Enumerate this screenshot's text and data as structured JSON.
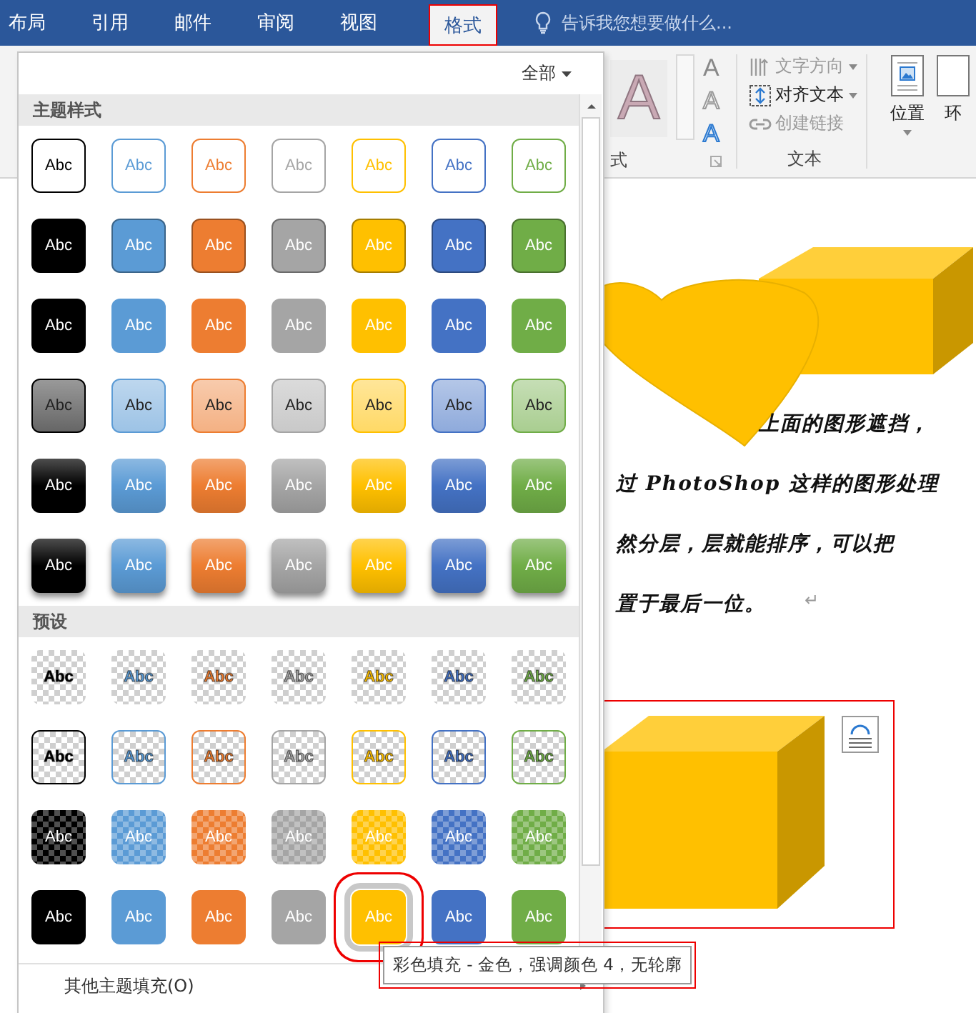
{
  "tabs": [
    {
      "label": "布局",
      "selected": false
    },
    {
      "label": "引用",
      "selected": false
    },
    {
      "label": "邮件",
      "selected": false
    },
    {
      "label": "审阅",
      "selected": false
    },
    {
      "label": "视图",
      "selected": false
    },
    {
      "label": "格式",
      "selected": true
    }
  ],
  "tell_me": {
    "placeholder": "告诉我您想要做什么..."
  },
  "ribbon": {
    "wordart_group": {
      "preview": "A",
      "title": "式",
      "buttons": [
        {
          "kind": "fill",
          "glyph": "A"
        },
        {
          "kind": "outline",
          "glyph": "A"
        },
        {
          "kind": "effects",
          "glyph": "A"
        }
      ]
    },
    "text_group": {
      "title": "文本",
      "items": [
        {
          "kind": "text-direction",
          "label": "文字方向",
          "disabled": true,
          "dropdown": true
        },
        {
          "kind": "align",
          "label": "对齐文本",
          "disabled": false,
          "dropdown": true
        },
        {
          "kind": "link",
          "label": "创建链接",
          "disabled": true,
          "dropdown": false
        }
      ]
    },
    "position_button": {
      "label": "位置"
    },
    "wrap_button": {
      "label": "环"
    }
  },
  "gallery": {
    "filter": "全部",
    "sections": [
      {
        "title": "主题样式",
        "rows": [
          {
            "kind": "outline",
            "swatches": [
              {
                "label": "Abc",
                "color": "#000000",
                "selected": false
              },
              {
                "label": "Abc",
                "color": "#5b9bd5",
                "selected": false
              },
              {
                "label": "Abc",
                "color": "#ed7d31",
                "selected": false
              },
              {
                "label": "Abc",
                "color": "#a5a5a5",
                "selected": false
              },
              {
                "label": "Abc",
                "color": "#ffc000",
                "selected": false
              },
              {
                "label": "Abc",
                "color": "#4472c4",
                "selected": false
              },
              {
                "label": "Abc",
                "color": "#70ad47",
                "selected": false
              }
            ]
          },
          {
            "kind": "bordered",
            "swatches": [
              {
                "label": "Abc",
                "color": "#000000",
                "selected": false
              },
              {
                "label": "Abc",
                "color": "#5b9bd5",
                "selected": false
              },
              {
                "label": "Abc",
                "color": "#ed7d31",
                "selected": false
              },
              {
                "label": "Abc",
                "color": "#a5a5a5",
                "selected": false
              },
              {
                "label": "Abc",
                "color": "#ffc000",
                "selected": false
              },
              {
                "label": "Abc",
                "color": "#4472c4",
                "selected": false
              },
              {
                "label": "Abc",
                "color": "#70ad47",
                "selected": false
              }
            ]
          },
          {
            "kind": "solid",
            "swatches": [
              {
                "label": "Abc",
                "color": "#000000",
                "selected": false
              },
              {
                "label": "Abc",
                "color": "#5b9bd5",
                "selected": false
              },
              {
                "label": "Abc",
                "color": "#ed7d31",
                "selected": false
              },
              {
                "label": "Abc",
                "color": "#a5a5a5",
                "selected": false
              },
              {
                "label": "Abc",
                "color": "#ffc000",
                "selected": false
              },
              {
                "label": "Abc",
                "color": "#4472c4",
                "selected": false
              },
              {
                "label": "Abc",
                "color": "#70ad47",
                "selected": false
              }
            ]
          },
          {
            "kind": "subtle",
            "swatches": [
              {
                "label": "Abc",
                "color": "#000000",
                "selected": false
              },
              {
                "label": "Abc",
                "color": "#5b9bd5",
                "selected": false
              },
              {
                "label": "Abc",
                "color": "#ed7d31",
                "selected": false
              },
              {
                "label": "Abc",
                "color": "#a5a5a5",
                "selected": false
              },
              {
                "label": "Abc",
                "color": "#ffc000",
                "selected": false
              },
              {
                "label": "Abc",
                "color": "#4472c4",
                "selected": false
              },
              {
                "label": "Abc",
                "color": "#70ad47",
                "selected": false
              }
            ]
          },
          {
            "kind": "moderate",
            "swatches": [
              {
                "label": "Abc",
                "color": "#000000",
                "selected": false
              },
              {
                "label": "Abc",
                "color": "#5b9bd5",
                "selected": false
              },
              {
                "label": "Abc",
                "color": "#ed7d31",
                "selected": false
              },
              {
                "label": "Abc",
                "color": "#a5a5a5",
                "selected": false
              },
              {
                "label": "Abc",
                "color": "#ffc000",
                "selected": false
              },
              {
                "label": "Abc",
                "color": "#4472c4",
                "selected": false
              },
              {
                "label": "Abc",
                "color": "#70ad47",
                "selected": false
              }
            ]
          },
          {
            "kind": "intense",
            "swatches": [
              {
                "label": "Abc",
                "color": "#000000",
                "selected": false
              },
              {
                "label": "Abc",
                "color": "#5b9bd5",
                "selected": false
              },
              {
                "label": "Abc",
                "color": "#ed7d31",
                "selected": false
              },
              {
                "label": "Abc",
                "color": "#a5a5a5",
                "selected": false
              },
              {
                "label": "Abc",
                "color": "#ffc000",
                "selected": false
              },
              {
                "label": "Abc",
                "color": "#4472c4",
                "selected": false
              },
              {
                "label": "Abc",
                "color": "#70ad47",
                "selected": false
              }
            ]
          }
        ]
      },
      {
        "title": "预设",
        "rows": [
          {
            "kind": "transparent",
            "swatches": [
              {
                "label": "Abc",
                "color": "#000000",
                "selected": false
              },
              {
                "label": "Abc",
                "color": "#5b9bd5",
                "selected": false
              },
              {
                "label": "Abc",
                "color": "#ed7d31",
                "selected": false
              },
              {
                "label": "Abc",
                "color": "#a5a5a5",
                "selected": false
              },
              {
                "label": "Abc",
                "color": "#ffc000",
                "selected": false
              },
              {
                "label": "Abc",
                "color": "#4472c4",
                "selected": false
              },
              {
                "label": "Abc",
                "color": "#70ad47",
                "selected": false
              }
            ]
          },
          {
            "kind": "transparent-outline",
            "swatches": [
              {
                "label": "Abc",
                "color": "#000000",
                "selected": false
              },
              {
                "label": "Abc",
                "color": "#5b9bd5",
                "selected": false
              },
              {
                "label": "Abc",
                "color": "#ed7d31",
                "selected": false
              },
              {
                "label": "Abc",
                "color": "#a5a5a5",
                "selected": false
              },
              {
                "label": "Abc",
                "color": "#ffc000",
                "selected": false
              },
              {
                "label": "Abc",
                "color": "#4472c4",
                "selected": false
              },
              {
                "label": "Abc",
                "color": "#70ad47",
                "selected": false
              }
            ]
          },
          {
            "kind": "tint",
            "swatches": [
              {
                "label": "Abc",
                "color": "#000000",
                "selected": false
              },
              {
                "label": "Abc",
                "color": "#5b9bd5",
                "selected": false
              },
              {
                "label": "Abc",
                "color": "#ed7d31",
                "selected": false
              },
              {
                "label": "Abc",
                "color": "#a5a5a5",
                "selected": false
              },
              {
                "label": "Abc",
                "color": "#ffc000",
                "selected": false
              },
              {
                "label": "Abc",
                "color": "#4472c4",
                "selected": false
              },
              {
                "label": "Abc",
                "color": "#70ad47",
                "selected": false
              }
            ]
          },
          {
            "kind": "solid",
            "swatches": [
              {
                "label": "Abc",
                "color": "#000000",
                "selected": false
              },
              {
                "label": "Abc",
                "color": "#5b9bd5",
                "selected": false
              },
              {
                "label": "Abc",
                "color": "#ed7d31",
                "selected": false
              },
              {
                "label": "Abc",
                "color": "#a5a5a5",
                "selected": false
              },
              {
                "label": "Abc",
                "color": "#ffc000",
                "selected": true
              },
              {
                "label": "Abc",
                "color": "#4472c4",
                "selected": false
              },
              {
                "label": "Abc",
                "color": "#70ad47",
                "selected": false
              }
            ]
          }
        ]
      }
    ],
    "more_fills": "其他主题填充(O)",
    "tooltip": "彩色填充 - 金色，强调颜色 4，无轮廓"
  },
  "document": {
    "lines": [
      "上面的图形遮挡，",
      "过 PhotoShop 这样的图形处理",
      "然分层，层就能排序，可以把",
      "置于最后一位。"
    ],
    "paragraph_mark": "↵"
  }
}
